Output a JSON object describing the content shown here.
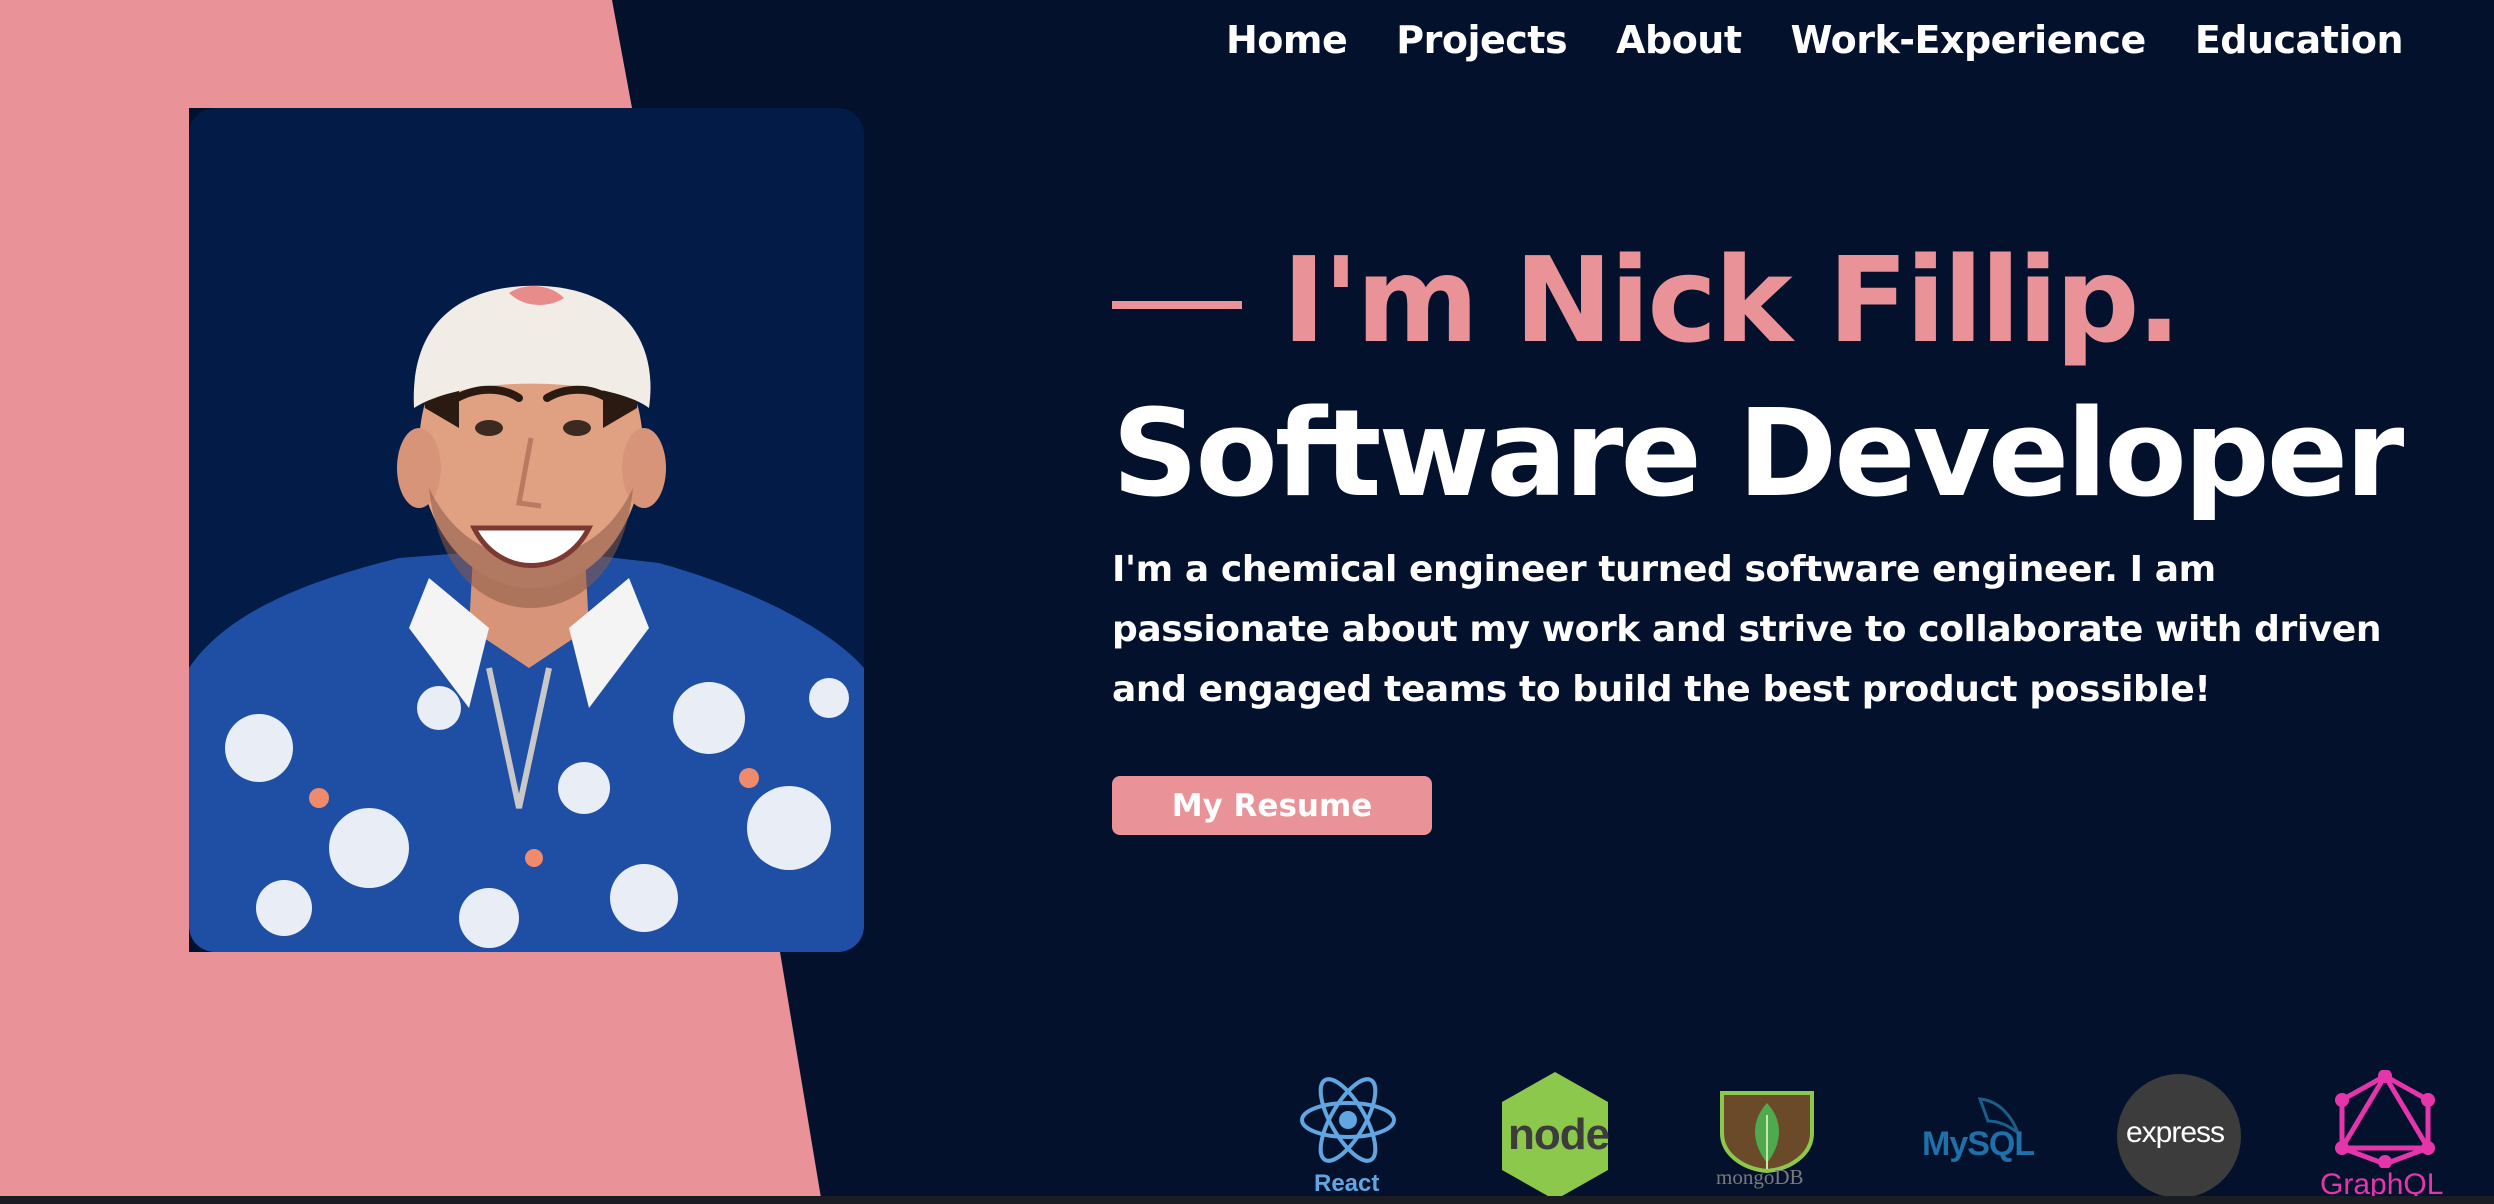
{
  "nav": {
    "items": [
      {
        "label": "Home"
      },
      {
        "label": "Projects"
      },
      {
        "label": "About"
      },
      {
        "label": "Work-Experience"
      },
      {
        "label": "Education"
      }
    ]
  },
  "hero": {
    "intro": "I'm Nick Fillip.",
    "role": "Software Developer",
    "bio": "I'm a chemical engineer turned software engineer. I am passionate about my work and strive to collaborate with driven and engaged teams to build the best product possible!",
    "resume_button": "My Resume"
  },
  "tech_stack": {
    "react": "React",
    "node": "node",
    "mongodb": "mongoDB",
    "mysql": "MySQL",
    "express": "express",
    "graphql": "GraphQL"
  },
  "colors": {
    "background": "#03112c",
    "accent_pink": "#e99399",
    "photo_bg": "#021b47",
    "text": "#ffffff"
  },
  "icons": [
    "profile-photo",
    "react-icon",
    "node-icon",
    "mongodb-icon",
    "mysql-icon",
    "express-icon",
    "graphql-icon"
  ]
}
